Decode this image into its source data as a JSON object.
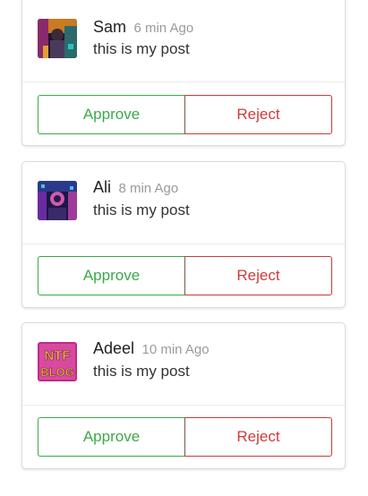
{
  "colors": {
    "approve": "#3aaa4a",
    "reject": "#d03a3a",
    "time": "#9a9a9a"
  },
  "posts": [
    {
      "name": "Sam",
      "time": "6 min Ago",
      "text": "this is my post",
      "avatar_icon": "sam-avatar-image",
      "approve_label": "Approve",
      "reject_label": "Reject"
    },
    {
      "name": "Ali",
      "time": "8 min Ago",
      "text": "this is my post",
      "avatar_icon": "ali-avatar-image",
      "approve_label": "Approve",
      "reject_label": "Reject"
    },
    {
      "name": "Adeel",
      "time": "10 min Ago",
      "text": "this is my post",
      "avatar_icon": "ntf-blog-avatar-image",
      "avatar_text": "NTF BLOG",
      "approve_label": "Approve",
      "reject_label": "Reject"
    }
  ]
}
